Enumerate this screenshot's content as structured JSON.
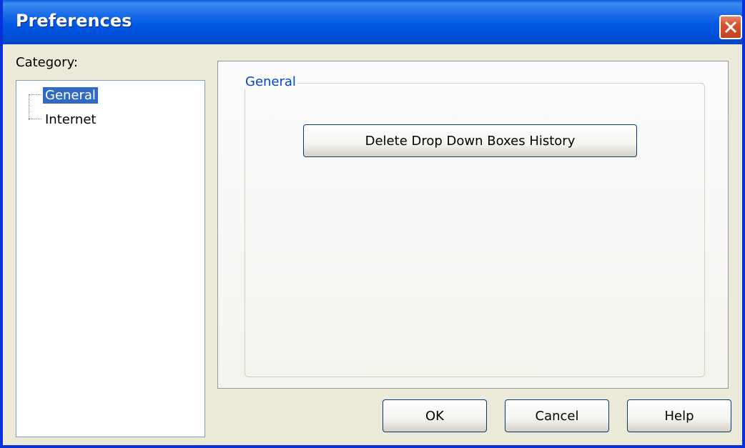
{
  "window": {
    "title": "Preferences",
    "close_icon": "close-icon"
  },
  "sidebar": {
    "label": "Category:",
    "items": [
      {
        "label": "General",
        "selected": true
      },
      {
        "label": "Internet",
        "selected": false
      }
    ]
  },
  "main": {
    "group_title": "General",
    "delete_history_label": "Delete Drop Down Boxes History"
  },
  "footer": {
    "ok_label": "OK",
    "cancel_label": "Cancel",
    "help_label": "Help"
  },
  "colors": {
    "title_bar": "#0058e4",
    "selection": "#316ac5",
    "group_title": "#0046d5",
    "close_button": "#d4532f"
  }
}
